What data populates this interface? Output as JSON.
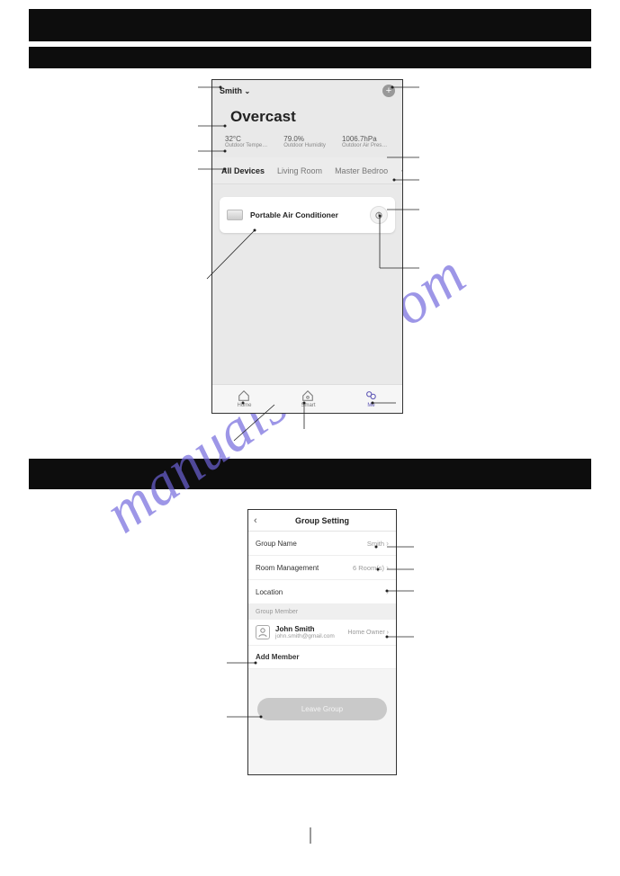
{
  "watermark": "manualshive.com",
  "phone1": {
    "home_name": "Smith",
    "weather_condition": "Overcast",
    "stats": [
      {
        "value": "32°C",
        "label": "Outdoor Tempe…"
      },
      {
        "value": "79.0%",
        "label": "Outdoor Humidity"
      },
      {
        "value": "1006.7hPa",
        "label": "Outdoor Air Pres…"
      }
    ],
    "tabs": [
      "All Devices",
      "Living Room",
      "Master Bedroo"
    ],
    "device": {
      "name": "Portable Air Conditioner"
    },
    "nav": [
      {
        "label": "Home"
      },
      {
        "label": "Smart"
      },
      {
        "label": "Me"
      }
    ]
  },
  "phone2": {
    "title": "Group Setting",
    "rows": {
      "group_name_label": "Group Name",
      "group_name_value": "Smith",
      "room_mgmt_label": "Room Management",
      "room_mgmt_value": "6 Room(s)",
      "location_label": "Location"
    },
    "section_label": "Group Member",
    "member": {
      "name": "John Smith",
      "email": "john.smith@gmail.com",
      "role": "Home Owner"
    },
    "add_member": "Add Member",
    "leave": "Leave Group"
  }
}
